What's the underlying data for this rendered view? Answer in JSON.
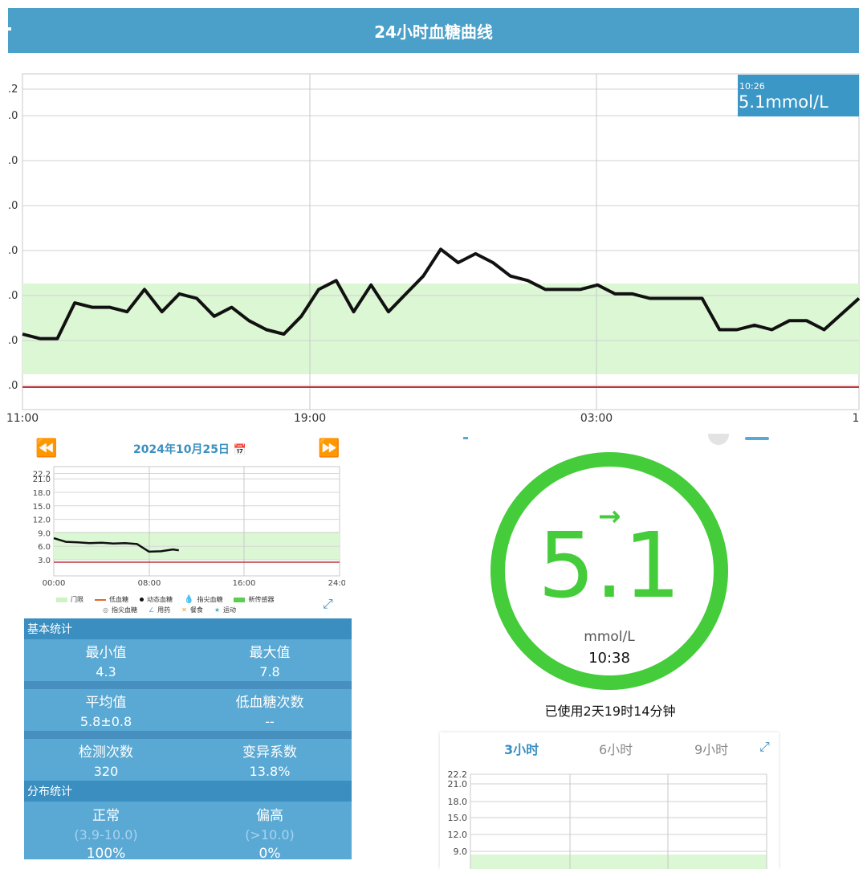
{
  "header": {
    "title": "24小时血糖曲线"
  },
  "tooltip": {
    "time": "10:26",
    "value": "5.1mmol/L"
  },
  "main_chart": {
    "y_ticks": [
      ".2",
      ".0",
      ".0",
      ".0",
      ".0",
      ".0",
      ".0",
      ".0"
    ],
    "x_ticks": [
      "11:00",
      "19:00",
      "03:00",
      "1"
    ],
    "colors": {
      "target_band": "#dcf7d4",
      "low_line": "#c0353a",
      "curve": "#111111"
    }
  },
  "date_nav": {
    "prev_icon": "double-left-arrow",
    "date": "2024年10月25日",
    "calendar_icon": "calendar-icon",
    "next_icon": "double-right-arrow"
  },
  "mini_chart": {
    "y_ticks": [
      "22.2",
      "21.0",
      "18.0",
      "15.0",
      "12.0",
      "9.0",
      "6.0",
      "3.0"
    ],
    "x_ticks": [
      "00:00",
      "08:00",
      "16:00",
      "24:00"
    ]
  },
  "legend": {
    "row1": [
      "门限",
      "低血糖",
      "动态血糖",
      "指尖血糖",
      "新传感器"
    ],
    "row2": [
      "指尖血糖",
      "用药",
      "餐食",
      "运动"
    ]
  },
  "basic_stats": {
    "title": "基本统计",
    "rows": [
      [
        {
          "label": "最小值",
          "value": "4.3"
        },
        {
          "label": "最大值",
          "value": "7.8"
        }
      ],
      [
        {
          "label": "平均值",
          "value": "5.8±0.8"
        },
        {
          "label": "低血糖次数",
          "value": "--"
        }
      ],
      [
        {
          "label": "检测次数",
          "value": "320"
        },
        {
          "label": "变异系数",
          "value": "13.8%"
        }
      ]
    ]
  },
  "distribution": {
    "title": "分布统计",
    "items": [
      {
        "label": "正常",
        "range": "(3.9-10.0)",
        "pct": "100%"
      },
      {
        "label": "偏高",
        "range": "(>10.0)",
        "pct": "0%"
      }
    ]
  },
  "current": {
    "value": "5.1",
    "unit": "mmol/L",
    "time": "10:38",
    "trend": "→",
    "color": "#44cc3a"
  },
  "usage": {
    "text": "已使用2天19时14分钟"
  },
  "range_tabs": {
    "tabs": [
      "3小时",
      "6小时",
      "9小时"
    ],
    "active": "3小时"
  },
  "card_chart": {
    "y_ticks": [
      "22.2",
      "21.0",
      "18.0",
      "15.0",
      "12.0",
      "9.0"
    ]
  },
  "chart_data": [
    {
      "type": "line",
      "name": "24h glucose",
      "x": [
        "11:00",
        "11:30",
        "12:00",
        "12:30",
        "13:00",
        "13:30",
        "14:00",
        "14:30",
        "15:00",
        "15:30",
        "16:00",
        "16:30",
        "17:00",
        "17:30",
        "18:00",
        "18:30",
        "19:00",
        "19:30",
        "20:00",
        "20:30",
        "21:00",
        "21:30",
        "22:00",
        "22:30",
        "23:00",
        "23:30",
        "00:00",
        "00:30",
        "01:00",
        "01:30",
        "02:00",
        "02:30",
        "03:00",
        "03:30",
        "04:00",
        "04:30",
        "05:00",
        "05:30",
        "06:00",
        "06:30",
        "07:00",
        "07:30",
        "08:00",
        "08:30",
        "09:00",
        "09:30",
        "10:00",
        "10:30"
      ],
      "y": [
        6.1,
        6.0,
        6.0,
        6.8,
        6.7,
        6.7,
        6.6,
        7.1,
        6.6,
        7.0,
        6.9,
        6.5,
        6.7,
        6.4,
        6.2,
        6.1,
        6.5,
        7.1,
        7.3,
        6.6,
        7.2,
        6.6,
        7.0,
        7.4,
        8.0,
        7.7,
        7.9,
        7.7,
        7.4,
        7.3,
        7.1,
        7.1,
        7.1,
        7.2,
        7.0,
        7.0,
        6.9,
        6.9,
        6.9,
        6.9,
        6.2,
        6.2,
        6.3,
        6.2,
        6.4,
        6.4,
        6.2,
        6.9
      ],
      "ylim": [
        3.0,
        22.2
      ],
      "target_range": [
        3.9,
        10.0
      ],
      "low_threshold": 3.9
    },
    {
      "type": "line",
      "name": "daily glucose",
      "x": [
        "00:00",
        "01:00",
        "02:00",
        "03:00",
        "04:00",
        "05:00",
        "06:00",
        "07:00",
        "08:00",
        "09:00",
        "10:00",
        "10:30"
      ],
      "y": [
        7.8,
        7.0,
        6.9,
        6.7,
        6.8,
        6.6,
        6.7,
        6.5,
        4.8,
        4.9,
        5.3,
        5.1
      ],
      "ylim": [
        3.0,
        22.2
      ],
      "x_range": [
        "00:00",
        "24:00"
      ],
      "target_range": [
        3.9,
        10.0
      ]
    }
  ]
}
